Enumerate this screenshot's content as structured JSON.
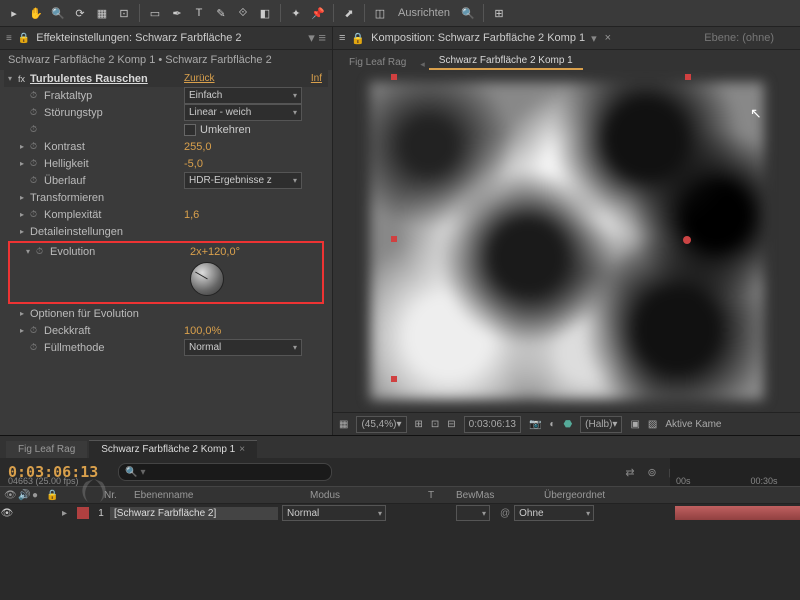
{
  "toolbar": {
    "ausrichten": "Ausrichten"
  },
  "effects": {
    "panel_title": "Effekteinstellungen: Schwarz Farbfläche 2",
    "breadcrumb": "Schwarz Farbfläche 2 Komp 1 • Schwarz Farbfläche 2",
    "effect_name": "Turbulentes Rauschen",
    "reset": "Zurück",
    "info": "Inf",
    "rows": {
      "fraktaltyp": {
        "label": "Fraktaltyp",
        "value": "Einfach"
      },
      "storungstyp": {
        "label": "Störungstyp",
        "value": "Linear - weich"
      },
      "umkehren": "Umkehren",
      "kontrast": {
        "label": "Kontrast",
        "value": "255,0"
      },
      "helligkeit": {
        "label": "Helligkeit",
        "value": "-5,0"
      },
      "uberlauf": {
        "label": "Überlauf",
        "value": "HDR-Ergebnisse z"
      },
      "transformieren": "Transformieren",
      "komplexitat": {
        "label": "Komplexität",
        "value": "1,6"
      },
      "detail": "Detaileinstellungen",
      "evolution": {
        "label": "Evolution",
        "value": "2x+120,0°"
      },
      "evo_options": "Optionen für Evolution",
      "deckkraft": {
        "label": "Deckkraft",
        "value": "100,0%"
      },
      "fullmethode": {
        "label": "Füllmethode",
        "value": "Normal"
      }
    }
  },
  "viewer": {
    "title": "Komposition: Schwarz Farbfläche 2 Komp 1",
    "ebene": "Ebene: (ohne)",
    "tab1": "Fig Leaf Rag",
    "tab2": "Schwarz Farbfläche 2 Komp 1",
    "footer": {
      "mag": "(45,4%)",
      "time": "0:03:06:13",
      "res": "(Halb)",
      "camera": "Aktive Kame"
    }
  },
  "timeline": {
    "tab1": "Fig Leaf Rag",
    "tab2": "Schwarz Farbfläche 2 Komp 1",
    "timecode": "0:03:06:13",
    "fps": "04663 (25.00 fps)",
    "ruler": [
      "00s",
      "00:30s"
    ],
    "columns": {
      "nr": "Nr.",
      "ebenname": "Ebenenname",
      "modus": "Modus",
      "t": "T",
      "bewmas": "BewMas",
      "ubergeordnet": "Übergeordnet"
    },
    "layer": {
      "num": "1",
      "name": "[Schwarz Farbfläche 2]",
      "mode": "Normal",
      "parent": "Ohne"
    }
  }
}
